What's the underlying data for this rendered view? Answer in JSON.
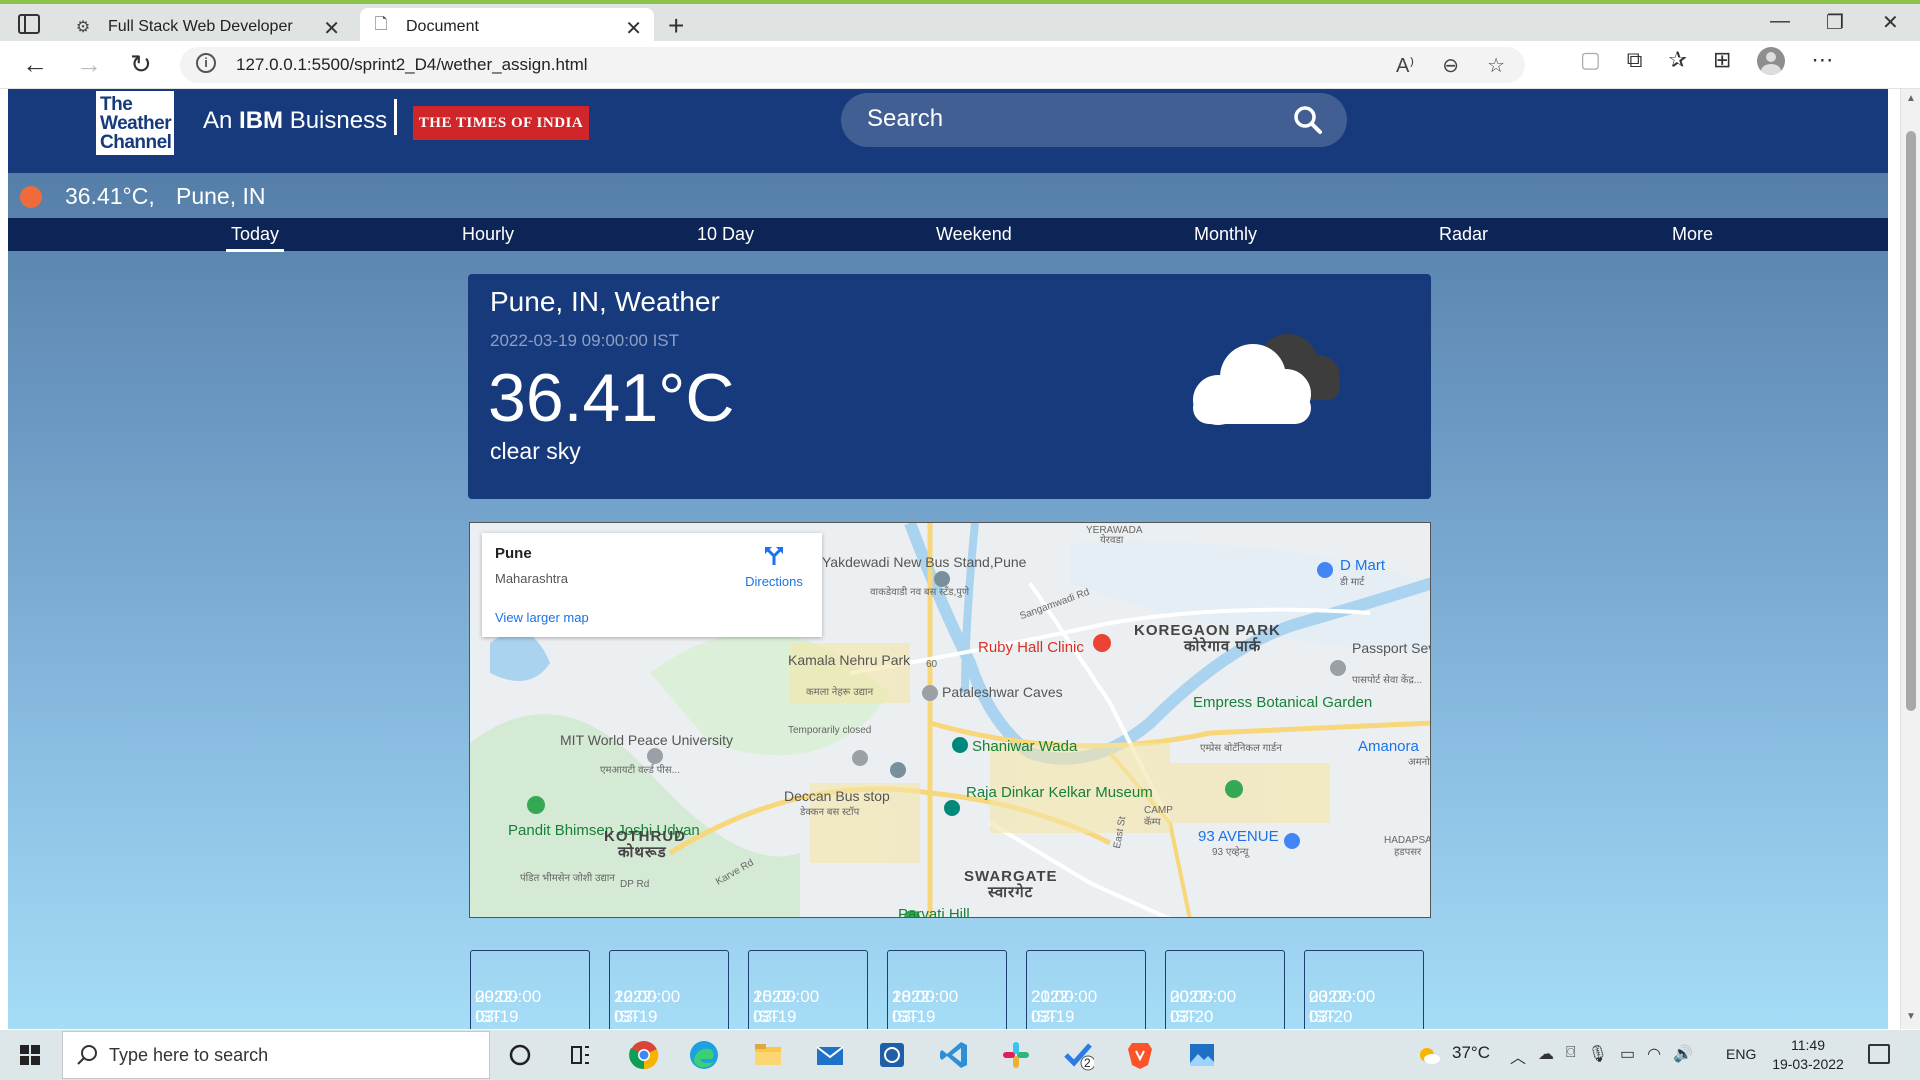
{
  "browser": {
    "tabs": [
      {
        "title": "Full Stack Web Developer",
        "icon": "page-icon"
      },
      {
        "title": "Document",
        "icon": "document-icon"
      }
    ],
    "url": "127.0.0.1:5500/sprint2_D4/wether_assign.html"
  },
  "site": {
    "logo_lines": [
      "The",
      "Weather",
      "Channel"
    ],
    "ibm_prefix": "An",
    "ibm_bold": "IBM",
    "ibm_suffix": "Buisness",
    "partner": "THE TIMES OF INDIA",
    "search_placeholder": "Search"
  },
  "current": {
    "temp": "36.41°C,",
    "city": "Pune, IN"
  },
  "menu": [
    "Today",
    "Hourly",
    "10 Day",
    "Weekend",
    "Monthly",
    "Radar",
    "More"
  ],
  "weather_card": {
    "title": "Pune, IN, Weather",
    "datetime": "2022-03-19 09:00:00 IST",
    "temp": "36.41°C",
    "description": "clear sky",
    "icon": "cloud-icon"
  },
  "map": {
    "place": "Pune",
    "region": "Maharashtra",
    "directions": "Directions",
    "larger_map": "View larger map",
    "labels": [
      "Yakdewadi New Bus Stand,Pune",
      "वाकडेवाडी नव बस स्टँड,पुणे",
      "Ruby Hall Clinic",
      "KOREGAON PARK",
      "कोरेगाव पार्क",
      "D Mart",
      "डी मार्ट",
      "Passport Seva Kendra(PSK)",
      "पासपोर्ट सेवा केंद्र...",
      "Kamala Nehru Park",
      "कमला नेहरू उद्यान",
      "Temporarily closed",
      "Pataleshwar Caves",
      "Empress Botanical Garden",
      "एम्प्रेस बोटॅनिकल गार्डन",
      "MIT World Peace University",
      "एमआयटी वर्ल्ड पीस...",
      "Shaniwar Wada",
      "Amanora",
      "अमनोरा",
      "Deccan Bus stop",
      "डेक्कन बस स्टॉप",
      "Raja Dinkar Kelkar Museum",
      "CAMP",
      "कॅम्प",
      "93 AVENUE",
      "93 एव्हेन्यू",
      "Pandit Bhimsen Joshi Udyan",
      "पंडित भीमसेन जोशी उद्यान",
      "KOTHRUD",
      "कोथरूड",
      "SWARGATE",
      "स्वारगेट",
      "Parvati Hill",
      "YERAWADA",
      "येरवडा",
      "Sangamwadi Rd",
      "Karve Rd",
      "DP Rd",
      "East St",
      "HADAPSAR",
      "हडपसर",
      "60"
    ]
  },
  "forecast": [
    {
      "date": "2022-03-19",
      "time": "09:00:00 IST"
    },
    {
      "date": "2022-03-19",
      "time": "12:00:00 IST"
    },
    {
      "date": "2022-03-19",
      "time": "15:00:00 IST"
    },
    {
      "date": "2022-03-19",
      "time": "18:00:00 IST"
    },
    {
      "date": "2022-03-19",
      "time": "21:00:00 IST"
    },
    {
      "date": "2022-03-20",
      "time": "00:00:00 IST"
    },
    {
      "date": "2022-03-20",
      "time": "03:00:00 IST"
    }
  ],
  "taskbar": {
    "search_placeholder": "Type here to search",
    "weather": "37°C",
    "language": "ENG",
    "time": "11:49",
    "date": "19-03-2022",
    "apps": [
      "task-view-icon",
      "cortana-icon",
      "chrome-icon",
      "edge-icon",
      "file-explorer-icon",
      "mail-icon",
      "app-icon",
      "vscode-icon",
      "slack-icon",
      "todo-icon",
      "brave-icon",
      "photos-icon"
    ],
    "todo_badge": "2"
  }
}
